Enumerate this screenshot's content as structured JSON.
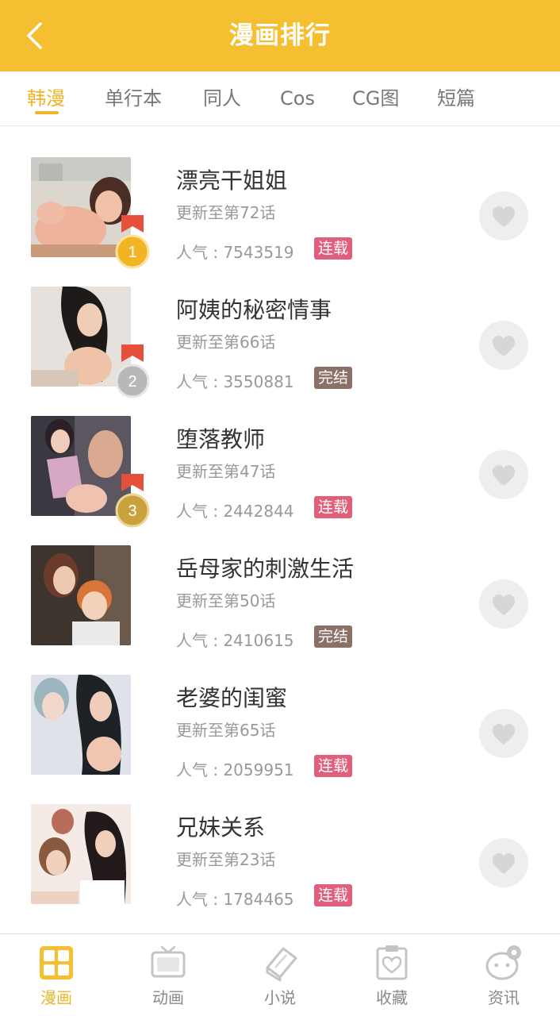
{
  "header": {
    "title": "漫画排行",
    "back_icon": "chevron-left-icon"
  },
  "tabs": [
    {
      "label": "韩漫",
      "active": true
    },
    {
      "label": "单行本",
      "active": false
    },
    {
      "label": "同人",
      "active": false
    },
    {
      "label": "Cos",
      "active": false
    },
    {
      "label": "CG图",
      "active": false
    },
    {
      "label": "短篇",
      "active": false
    }
  ],
  "comics": [
    {
      "title": "漂亮干姐姐",
      "update": "更新至第72话",
      "popularity": "人气 : 7543519",
      "status": "连载",
      "rank": "1",
      "medal_color": "#f2b325"
    },
    {
      "title": "阿姨的秘密情事",
      "update": "更新至第66话",
      "popularity": "人气 : 3550881",
      "status": "完结",
      "rank": "2",
      "medal_color": "#b8b8b8"
    },
    {
      "title": "堕落教师",
      "update": "更新至第47话",
      "popularity": "人气 : 2442844",
      "status": "连载",
      "rank": "3",
      "medal_color": "#c9a23b"
    },
    {
      "title": "岳母家的刺激生活",
      "update": "更新至第50话",
      "popularity": "人气 : 2410615",
      "status": "完结"
    },
    {
      "title": "老婆的闺蜜",
      "update": "更新至第65话",
      "popularity": "人气 : 2059951",
      "status": "连载"
    },
    {
      "title": "兄妹关系",
      "update": "更新至第23话",
      "popularity": "人气 : 1784465",
      "status": "连载"
    }
  ],
  "bottom_nav": [
    {
      "label": "漫画",
      "icon": "comic-grid-icon",
      "active": true
    },
    {
      "label": "动画",
      "icon": "tv-icon",
      "active": false
    },
    {
      "label": "小说",
      "icon": "book-icon",
      "active": false
    },
    {
      "label": "收藏",
      "icon": "heart-note-icon",
      "active": false
    },
    {
      "label": "资讯",
      "icon": "news-gear-icon",
      "active": false
    }
  ],
  "colors": {
    "accent": "#f5bf32",
    "serial_badge": "#e0607c",
    "done_badge": "#8b7068"
  }
}
